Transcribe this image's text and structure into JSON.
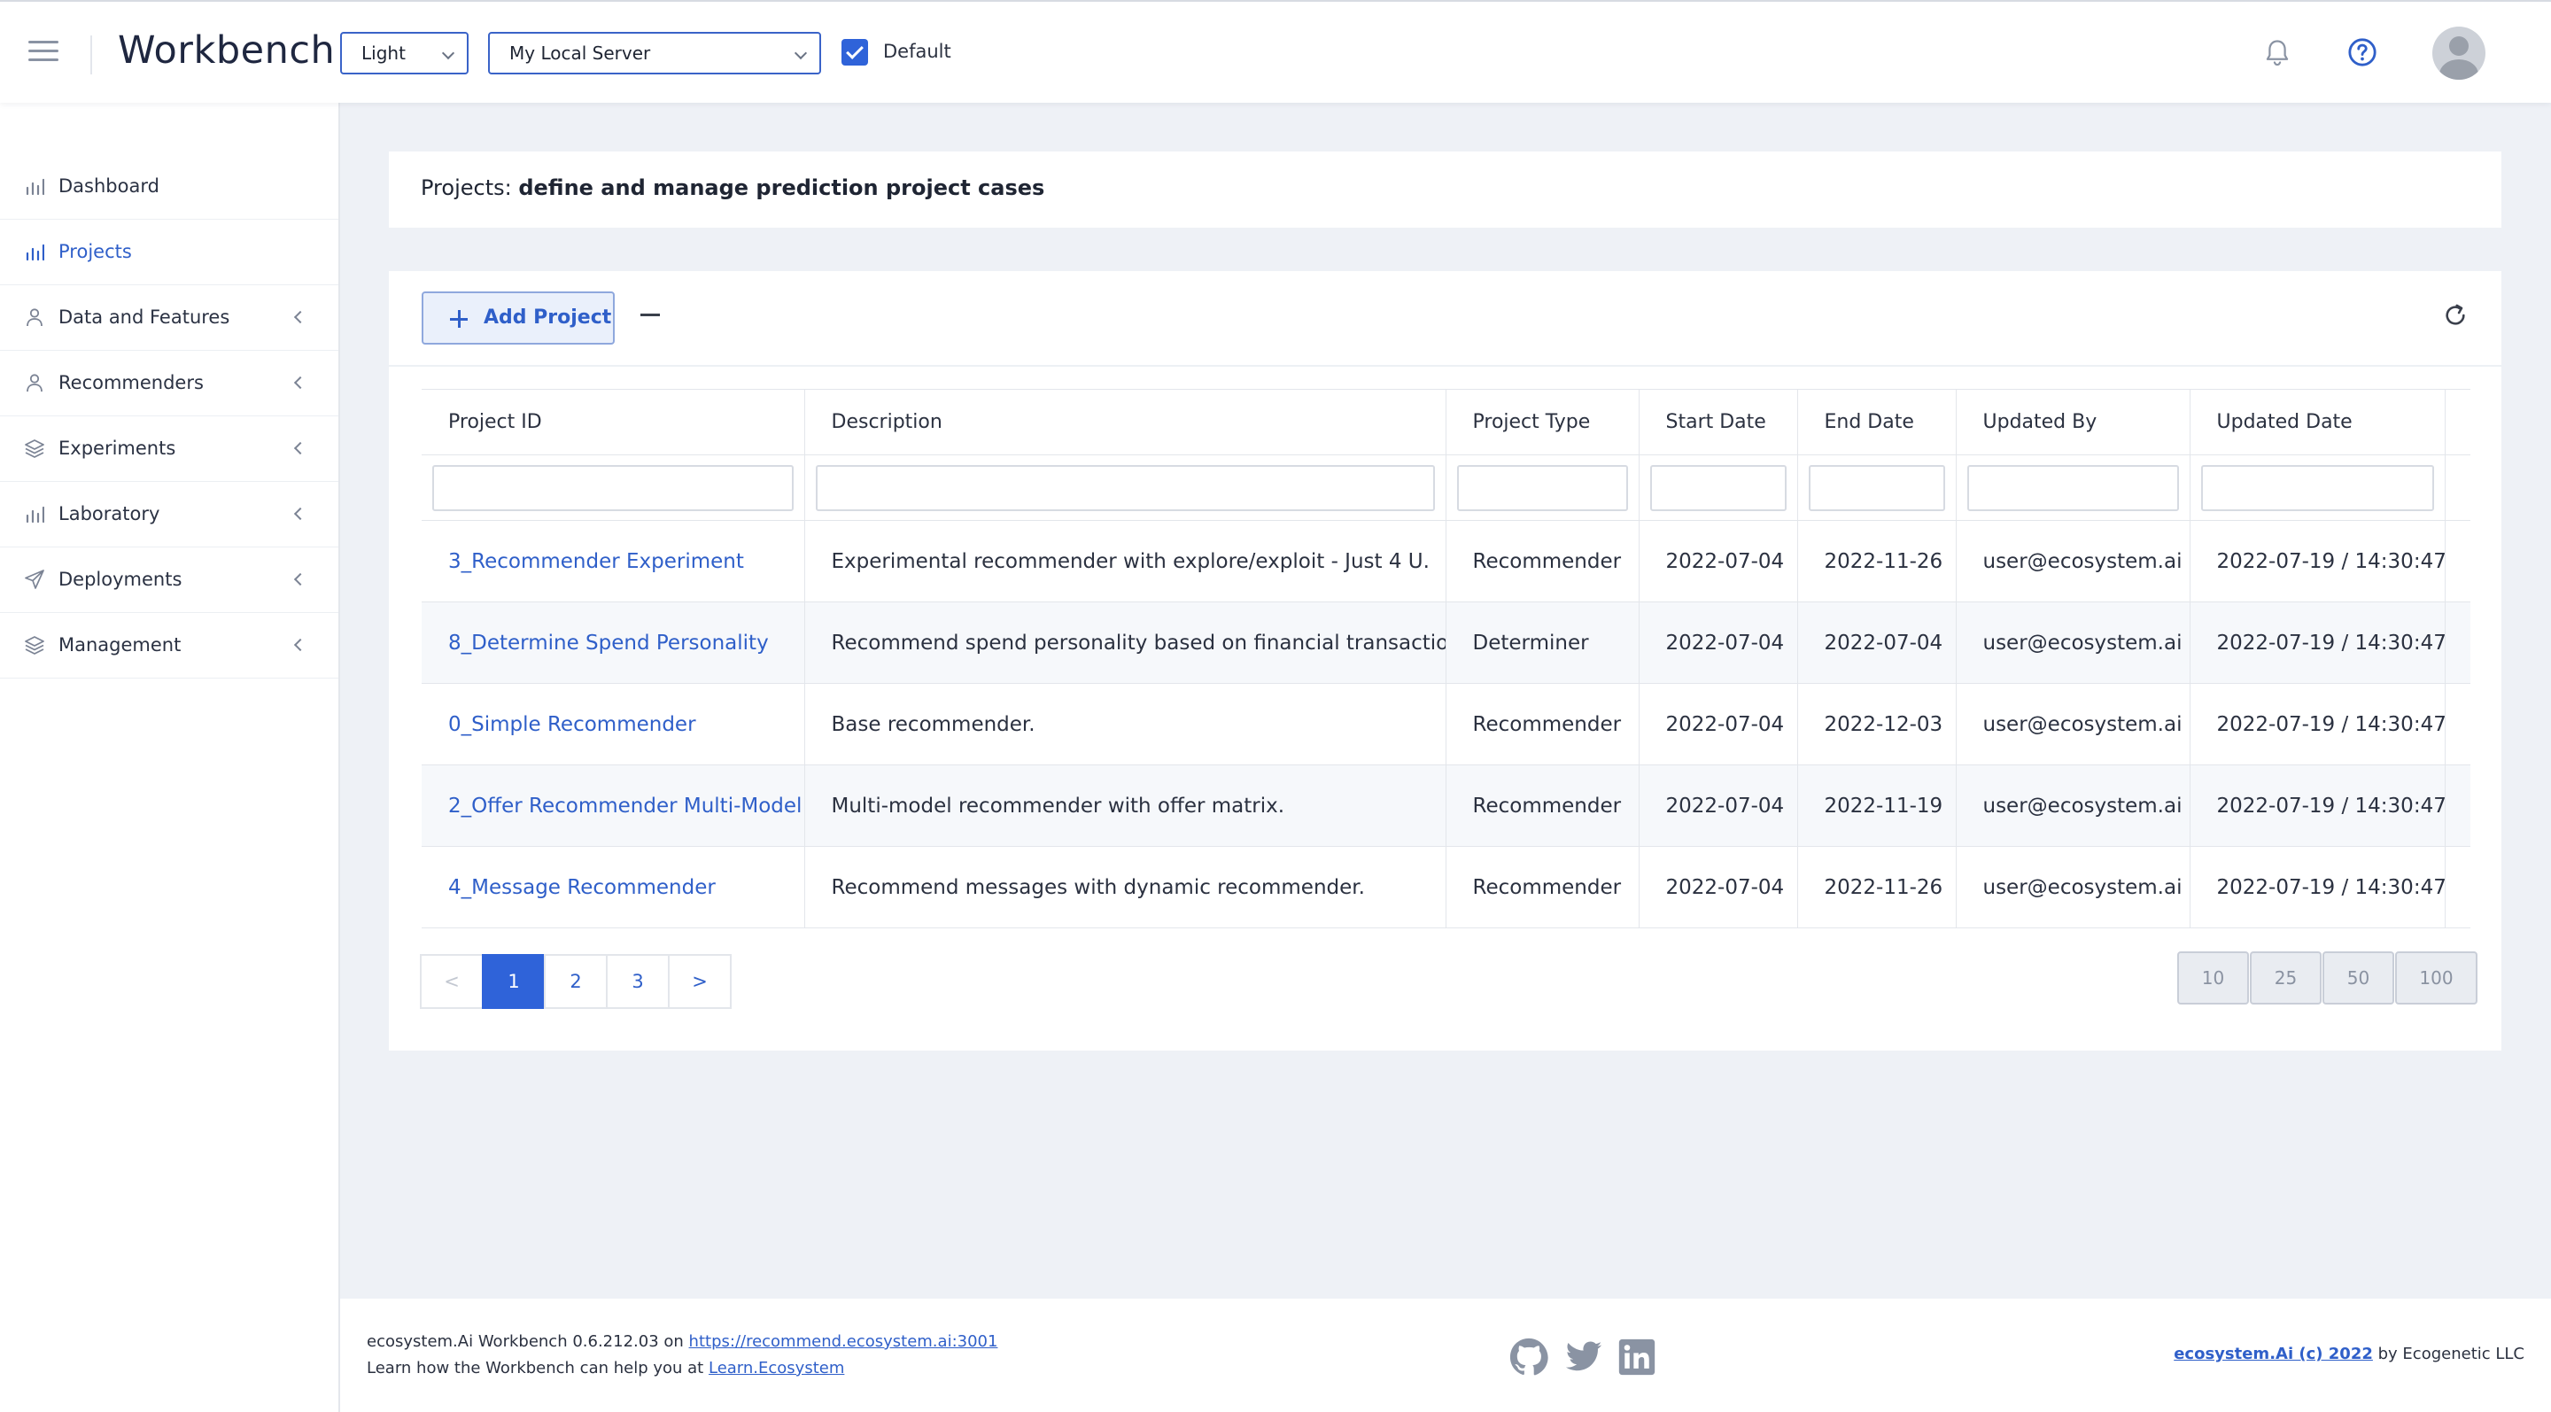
{
  "header": {
    "brand": "Workbench",
    "theme_value": "Light",
    "server_value": "My Local Server",
    "default_label": "Default"
  },
  "sidebar": {
    "items": [
      {
        "label": "Dashboard",
        "icon": "bar-chart-icon"
      },
      {
        "label": "Projects",
        "icon": "bar-chart-icon"
      },
      {
        "label": "Data and Features",
        "icon": "user-icon"
      },
      {
        "label": "Recommenders",
        "icon": "user-icon"
      },
      {
        "label": "Experiments",
        "icon": "layers-icon"
      },
      {
        "label": "Laboratory",
        "icon": "bar-chart-icon"
      },
      {
        "label": "Deployments",
        "icon": "send-icon"
      },
      {
        "label": "Management",
        "icon": "layers-icon"
      }
    ]
  },
  "page_title": {
    "prefix": "Projects:",
    "text": "define and manage prediction project cases"
  },
  "toolbar": {
    "add_label": "Add Project"
  },
  "table": {
    "columns": [
      "Project ID",
      "Description",
      "Project Type",
      "Start Date",
      "End Date",
      "Updated By",
      "Updated Date"
    ],
    "rows": [
      [
        "3_Recommender Experiment",
        "Experimental recommender with explore/exploit - Just 4 U.",
        "Recommender",
        "2022-07-04",
        "2022-11-26",
        "user@ecosystem.ai",
        "2022-07-19 / 14:30:47"
      ],
      [
        "8_Determine Spend Personality",
        "Recommend spend personality based on financial transactions.",
        "Determiner",
        "2022-07-04",
        "2022-07-04",
        "user@ecosystem.ai",
        "2022-07-19 / 14:30:47"
      ],
      [
        "0_Simple Recommender",
        "Base recommender.",
        "Recommender",
        "2022-07-04",
        "2022-12-03",
        "user@ecosystem.ai",
        "2022-07-19 / 14:30:47"
      ],
      [
        "2_Offer Recommender Multi-Model",
        "Multi-model recommender with offer matrix.",
        "Recommender",
        "2022-07-04",
        "2022-11-19",
        "user@ecosystem.ai",
        "2022-07-19 / 14:30:47"
      ],
      [
        "4_Message Recommender",
        "Recommend messages with dynamic recommender.",
        "Recommender",
        "2022-07-04",
        "2022-11-26",
        "user@ecosystem.ai",
        "2022-07-19 / 14:30:47"
      ]
    ]
  },
  "pagination": {
    "prev": "<",
    "pages": [
      "1",
      "2",
      "3"
    ],
    "next": ">",
    "page_sizes": [
      "10",
      "25",
      "50",
      "100"
    ]
  },
  "footer": {
    "version_text": "ecosystem.Ai Workbench 0.6.212.03 on",
    "server_link": "https://recommend.ecosystem.ai:3001",
    "learn_text": "Learn how the Workbench can help you at",
    "learn_link": "Learn.Ecosystem",
    "copyright_link": "ecosystem.Ai (c) 2022",
    "copyright_suffix": "by Ecogenetic LLC"
  },
  "colors": {
    "accent": "#2f63d9",
    "link": "#2f5fc9",
    "page_bg": "#eef1f6"
  }
}
